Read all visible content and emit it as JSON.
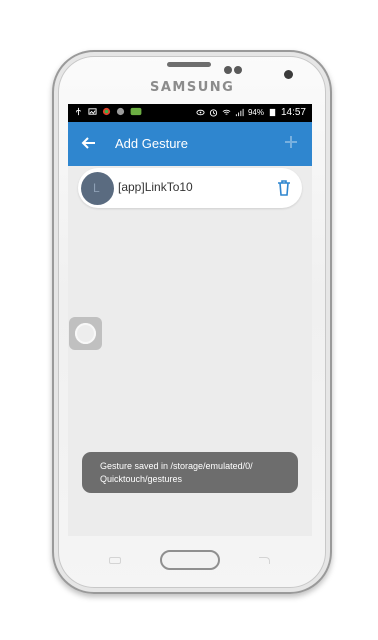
{
  "device": {
    "brand": "SAMSUNG"
  },
  "statusbar": {
    "battery_pct": "94%",
    "time": "14:57"
  },
  "appbar": {
    "title": "Add Gesture"
  },
  "gestures": [
    {
      "avatar_letter": "L",
      "label": "[app]LinkTo10"
    }
  ],
  "toast": {
    "text": "Gesture saved in /storage/emulated/0/ Quicktouch/gestures"
  },
  "colors": {
    "appbar": "#2f86cf",
    "accent_icon": "#2f86cf",
    "toast_bg": "#6d6d6d",
    "screen_bg": "#ececec"
  },
  "icons": [
    "usb-icon",
    "image-icon",
    "app-icon",
    "circle-icon",
    "sync-icon",
    "eye-icon",
    "alarm-icon",
    "wifi-icon",
    "signal-icon",
    "battery-icon",
    "back-arrow-icon",
    "plus-icon",
    "trash-icon"
  ]
}
